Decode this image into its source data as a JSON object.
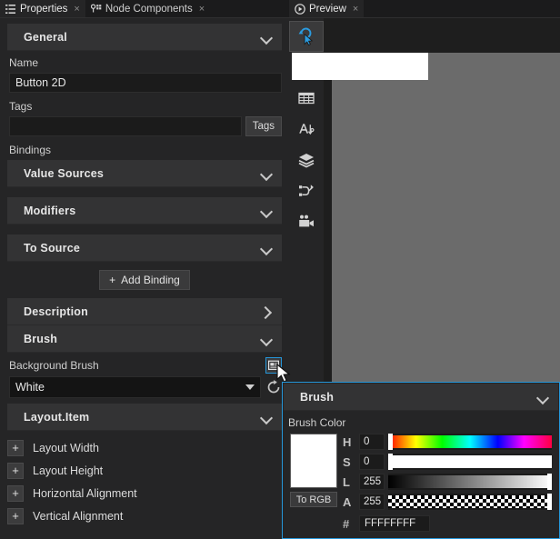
{
  "left_panel": {
    "tabs": [
      {
        "label": "Properties",
        "icon": "list-icon",
        "active": true,
        "close": "×"
      },
      {
        "label": "Node Components",
        "icon": "node-components-icon",
        "active": false,
        "close": "×"
      }
    ],
    "general_section": {
      "title": "General",
      "expanded": true
    },
    "name_label": "Name",
    "name_value": "Button 2D",
    "tags_label": "Tags",
    "tags_value": "",
    "tags_button": "Tags",
    "bindings_label": "Bindings",
    "binding_sections": [
      {
        "title": "Value Sources",
        "expanded": true
      },
      {
        "title": "Modifiers",
        "expanded": true
      },
      {
        "title": "To Source",
        "expanded": true
      }
    ],
    "add_binding_label": "Add Binding",
    "add_binding_plus": "+",
    "description_section": {
      "title": "Description",
      "expanded": false
    },
    "brush_section": {
      "title": "Brush",
      "expanded": true
    },
    "background_brush_label": "Background Brush",
    "background_brush_value": "White",
    "layout_item_section": {
      "title": "Layout.Item",
      "expanded": true
    },
    "layout_props": [
      {
        "label": "Layout Width",
        "expand": "+"
      },
      {
        "label": "Layout Height",
        "expand": "+"
      },
      {
        "label": "Horizontal Alignment",
        "expand": "+"
      },
      {
        "label": "Vertical Alignment",
        "expand": "+"
      }
    ]
  },
  "right_panel": {
    "tabs": [
      {
        "label": "Preview",
        "icon": "play-circle-icon",
        "active": true,
        "close": "×"
      }
    ],
    "tools": [
      {
        "name": "pointer-click-icon",
        "selected": true
      },
      {
        "name": "arrow-select-icon",
        "selected": false
      },
      {
        "name": "grid-icon",
        "selected": false
      },
      {
        "name": "text-icon",
        "selected": false
      },
      {
        "name": "layers-icon",
        "selected": false
      },
      {
        "name": "node-graph-icon",
        "selected": false
      },
      {
        "name": "camera-icon",
        "selected": false
      }
    ],
    "stage_bg_color": "#6b6b6b",
    "preview_object_color": "#ffffff"
  },
  "brush_popup": {
    "header_title": "Brush",
    "brush_color_label": "Brush Color",
    "to_rgb_label": "To RGB",
    "swatch_color": "#ffffff",
    "channels": [
      {
        "name": "H",
        "value": "0",
        "handle_pct": 0,
        "gradient": "hue"
      },
      {
        "name": "S",
        "value": "0",
        "handle_pct": 0,
        "gradient": "saturation"
      },
      {
        "name": "L",
        "value": "255",
        "handle_pct": 100,
        "gradient": "lightness"
      },
      {
        "name": "A",
        "value": "255",
        "handle_pct": 100,
        "gradient": "alpha"
      }
    ],
    "hex_label": "#",
    "hex_value": "FFFFFFFF",
    "accent_color": "#2596d9"
  }
}
